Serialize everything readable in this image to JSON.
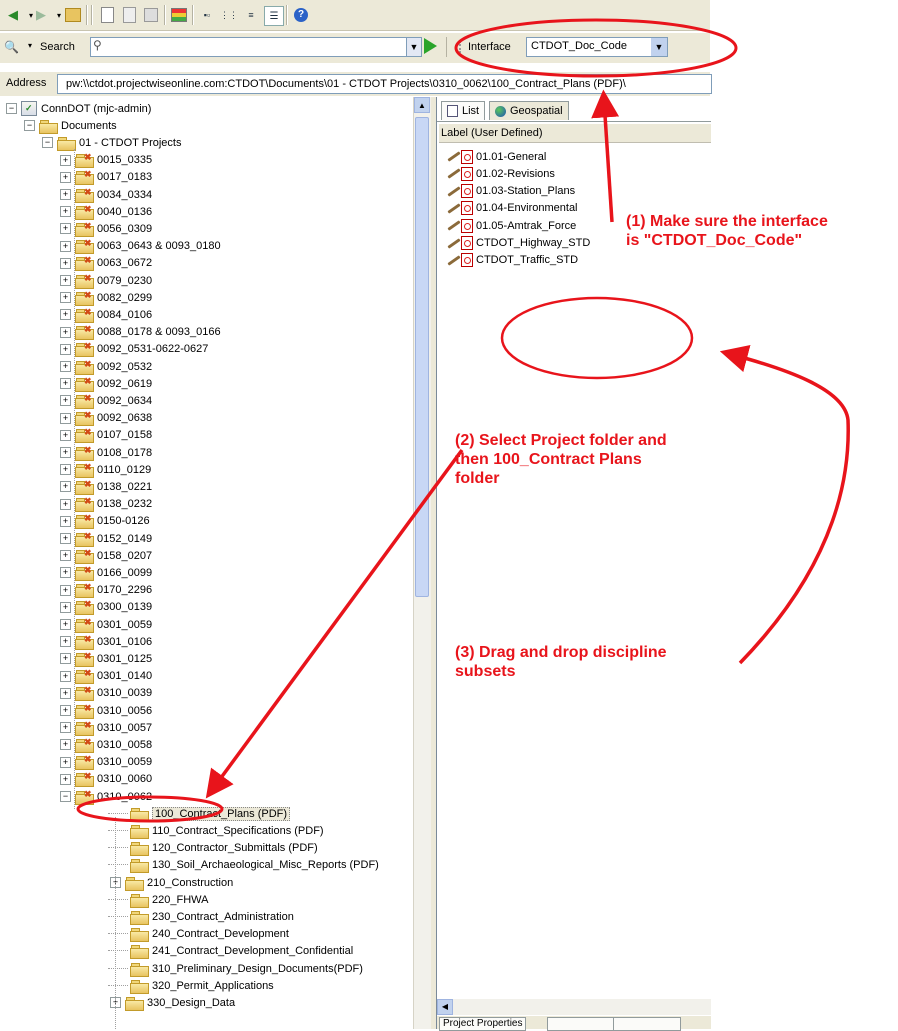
{
  "search": {
    "label": "Search"
  },
  "interface": {
    "label": "Interface",
    "value": "CTDOT_Doc_Code"
  },
  "address": {
    "label": "Address",
    "value": "pw:\\\\ctdot.projectwiseonline.com:CTDOT\\Documents\\01 - CTDOT Projects\\0310_0062\\100_Contract_Plans (PDF)\\"
  },
  "tree": {
    "root": "ConnDOT (mjc-admin)",
    "documents": "Documents",
    "projects_folder": "01 - CTDOT Projects",
    "projects": [
      "0015_0335",
      "0017_0183",
      "0034_0334",
      "0040_0136",
      "0056_0309",
      "0063_0643 & 0093_0180",
      "0063_0672",
      "0079_0230",
      "0082_0299",
      "0084_0106",
      "0088_0178 & 0093_0166",
      "0092_0531-0622-0627",
      "0092_0532",
      "0092_0619",
      "0092_0634",
      "0092_0638",
      "0107_0158",
      "0108_0178",
      "0110_0129",
      "0138_0221",
      "0138_0232",
      "0150-0126",
      "0152_0149",
      "0158_0207",
      "0166_0099",
      "0170_2296",
      "0300_0139",
      "0301_0059",
      "0301_0106",
      "0301_0125",
      "0301_0140",
      "0310_0039",
      "0310_0056",
      "0310_0057",
      "0310_0058",
      "0310_0059",
      "0310_0060"
    ],
    "selected_project": "0310_0062",
    "subfolders": [
      "100_Contract_Plans (PDF)",
      "110_Contract_Specifications (PDF)",
      "120_Contractor_Submittals (PDF)",
      "130_Soil_Archaeological_Misc_Reports (PDF)",
      "210_Construction",
      "220_FHWA",
      "230_Contract_Administration",
      "240_Contract_Development",
      "241_Contract_Development_Confidential",
      "310_Preliminary_Design_Documents(PDF)",
      "320_Permit_Applications",
      "330_Design_Data"
    ]
  },
  "right_pane": {
    "tabs": [
      "List",
      "Geospatial"
    ],
    "column_header": "Label (User Defined)",
    "files": [
      "01.01-General",
      "01.02-Revisions",
      "01.03-Station_Plans",
      "01.04-Environmental",
      "01.05-Amtrak_Force",
      "CTDOT_Highway_STD",
      "CTDOT_Traffic_STD"
    ],
    "bottom_tabs": [
      "Project Properties",
      "",
      ""
    ]
  },
  "annotations": {
    "step1": [
      "(1) Make sure the interface",
      "is \"CTDOT_Doc_Code\""
    ],
    "step2": [
      "(2) Select Project folder and",
      "then 100_Contract Plans",
      "folder"
    ],
    "step3": [
      "(3) Drag and drop discipline",
      "subsets"
    ]
  },
  "colors": {
    "annotation": "#e8141b",
    "toolbar_bg": "#ece9d8"
  }
}
